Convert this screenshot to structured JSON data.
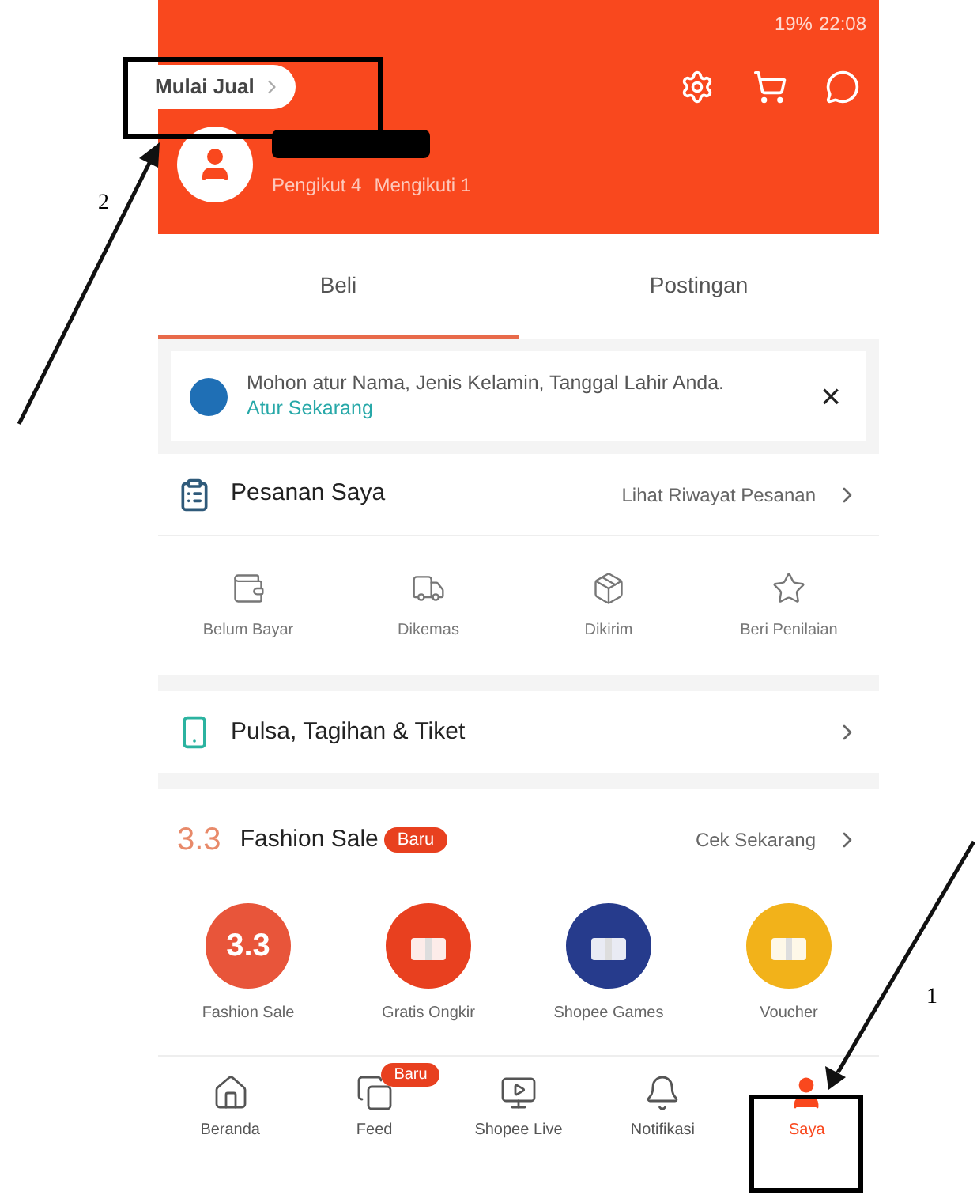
{
  "status_bar": {
    "battery": "19%",
    "time": "22:08"
  },
  "header": {
    "sell_button": "Mulai Jual",
    "followers": "Pengikut 4",
    "following": "Mengikuti 1"
  },
  "tabs": [
    {
      "label": "Beli",
      "selected": true
    },
    {
      "label": "Postingan",
      "selected": false
    }
  ],
  "notice": {
    "text": "Mohon atur Nama, Jenis Kelamin, Tanggal Lahir Anda.",
    "link": "Atur Sekarang",
    "close": "×"
  },
  "orders": {
    "title": "Pesanan Saya",
    "link": "Lihat Riwayat Pesanan",
    "statuses": [
      {
        "label": "Belum Bayar"
      },
      {
        "label": "Dikemas"
      },
      {
        "label": "Dikirim"
      },
      {
        "label": "Beri Penilaian"
      }
    ]
  },
  "bills": {
    "title": "Pulsa, Tagihan & Tiket"
  },
  "promo": {
    "logo": "3.3",
    "title": "Fashion Sale",
    "badge": "Baru",
    "link": "Cek Sekarang",
    "items": [
      {
        "label": "Fashion Sale",
        "color": "#e8553a",
        "text": "3.3"
      },
      {
        "label": "Gratis Ongkir",
        "color": "#e8401f"
      },
      {
        "label": "Shopee Games",
        "color": "#263b8c"
      },
      {
        "label": "Voucher",
        "color": "#f2b21a"
      }
    ]
  },
  "bottom_nav": [
    {
      "label": "Beranda",
      "selected": false
    },
    {
      "label": "Feed",
      "selected": false,
      "badge": "Baru"
    },
    {
      "label": "Shopee Live",
      "selected": false
    },
    {
      "label": "Notifikasi",
      "selected": false
    },
    {
      "label": "Saya",
      "selected": true
    }
  ],
  "annotations": [
    {
      "label": "2"
    },
    {
      "label": "1"
    }
  ]
}
